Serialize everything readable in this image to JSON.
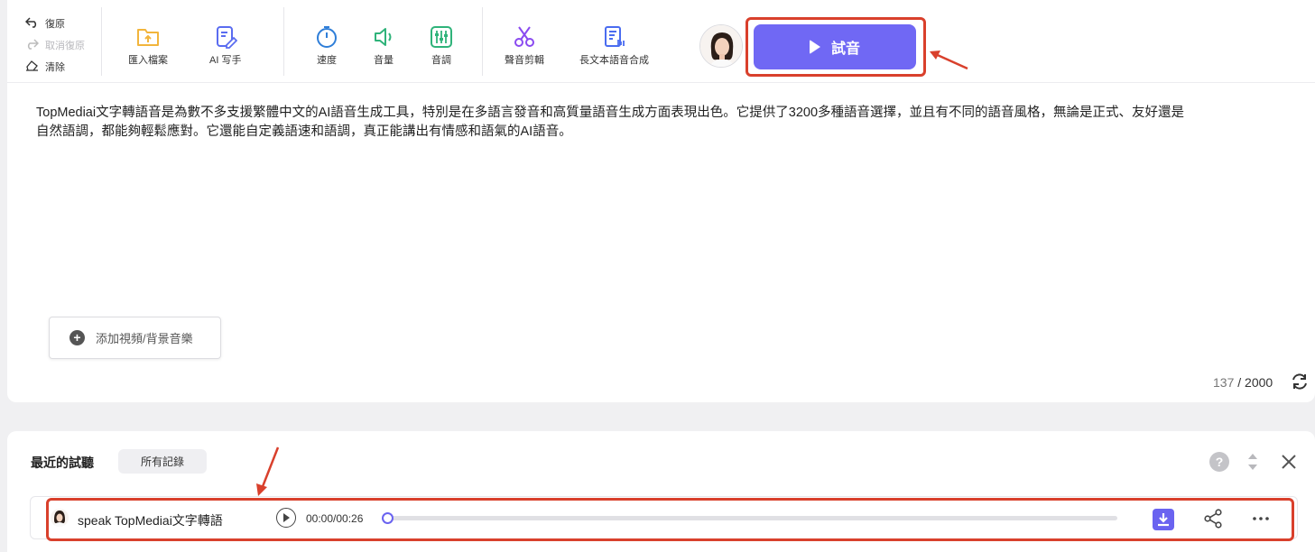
{
  "toolbar": {
    "undo_label": "復原",
    "redo_label": "取消復原",
    "clear_label": "清除",
    "import_label": "匯入檔案",
    "ai_writer_label": "AI 写手",
    "speed_label": "速度",
    "volume_label": "音量",
    "pitch_label": "音調",
    "audio_cut_label": "聲音剪輯",
    "long_text_label": "長文本語音合成",
    "play_label": "試音"
  },
  "editor": {
    "text_line1": "TopMediai文字轉語音是為數不多支援繁體中文的AI語音生成工具，特別是在多語言發音和高質量語音生成方面表現出色。它提供了3200多種語音選擇，並且有不同的語音風格，無論是正式、友好還是",
    "text_line2": "自然語調，都能夠輕鬆應對。它還能自定義語速和語調，真正能講出有情感和語氣的AI語音。",
    "add_media_label": "添加視頻/背景音樂",
    "char_count": "137",
    "char_sep": "/",
    "char_max": "2000"
  },
  "history": {
    "title": "最近的試聽",
    "all_records_label": "所有記錄",
    "help_symbol": "?",
    "track": {
      "name": "speak TopMediai文字轉語",
      "time": "00:00/00:26",
      "progress": 0
    }
  },
  "colors": {
    "accent": "#7068f4",
    "highlight_red": "#d9402c",
    "folder_orange": "#f2b53c",
    "ai_blue": "#5a6cf0",
    "speed_blue": "#2f7ed8",
    "volume_green": "#2fb37a",
    "pitch_green": "#2fb37a",
    "cut_purple": "#8a4af0",
    "long_text_blue": "#4a6cf0"
  }
}
